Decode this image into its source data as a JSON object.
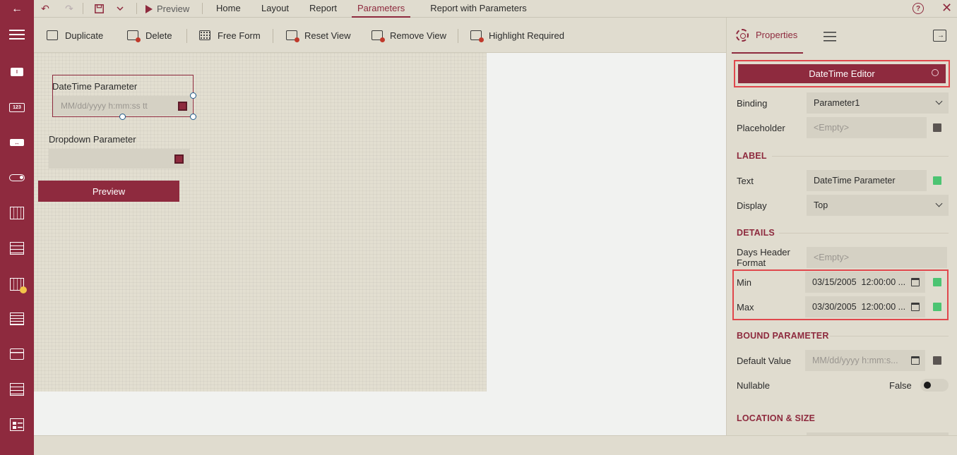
{
  "window": {
    "title": "Report with Parameters",
    "menu": [
      "Home",
      "Layout",
      "Report",
      "Parameters"
    ],
    "active_menu": "Parameters",
    "preview_label": "Preview",
    "colors": {
      "accent": "#8e2a3e",
      "highlight": "#e0474c",
      "ok": "#4cc472",
      "neutral": "#5b5552"
    }
  },
  "toolbar": {
    "duplicate": "Duplicate",
    "delete": "Delete",
    "free_form": "Free Form",
    "reset_view": "Reset View",
    "remove_view": "Remove View",
    "highlight_required": "Highlight Required"
  },
  "canvas": {
    "datetime_label": "DateTime Parameter",
    "datetime_placeholder": "MM/dd/yyyy h:mm:ss tt",
    "dropdown_label": "Dropdown Parameter",
    "preview_button": "Preview"
  },
  "panel": {
    "tab_properties": "Properties",
    "editor_title": "DateTime Editor",
    "binding_label": "Binding",
    "binding_value": "Parameter1",
    "placeholder_label": "Placeholder",
    "placeholder_value": "<Empty>",
    "section_label": "LABEL",
    "text_label": "Text",
    "text_value": "DateTime Parameter",
    "display_label": "Display",
    "display_value": "Top",
    "section_details": "DETAILS",
    "days_header_label_1": "Days Header",
    "days_header_label_2": "Format",
    "days_header_value": "<Empty>",
    "min_label": "Min",
    "min_value": "03/15/2005  12:00:00 ...",
    "max_label": "Max",
    "max_value": "03/30/2005  12:00:00 ...",
    "section_bound": "BOUND PARAMETER",
    "default_value_label": "Default Value",
    "default_value_placeholder": "MM/dd/yyyy h:mm:s...",
    "nullable_label": "Nullable",
    "nullable_value": "False",
    "section_location": "LOCATION & SIZE"
  }
}
